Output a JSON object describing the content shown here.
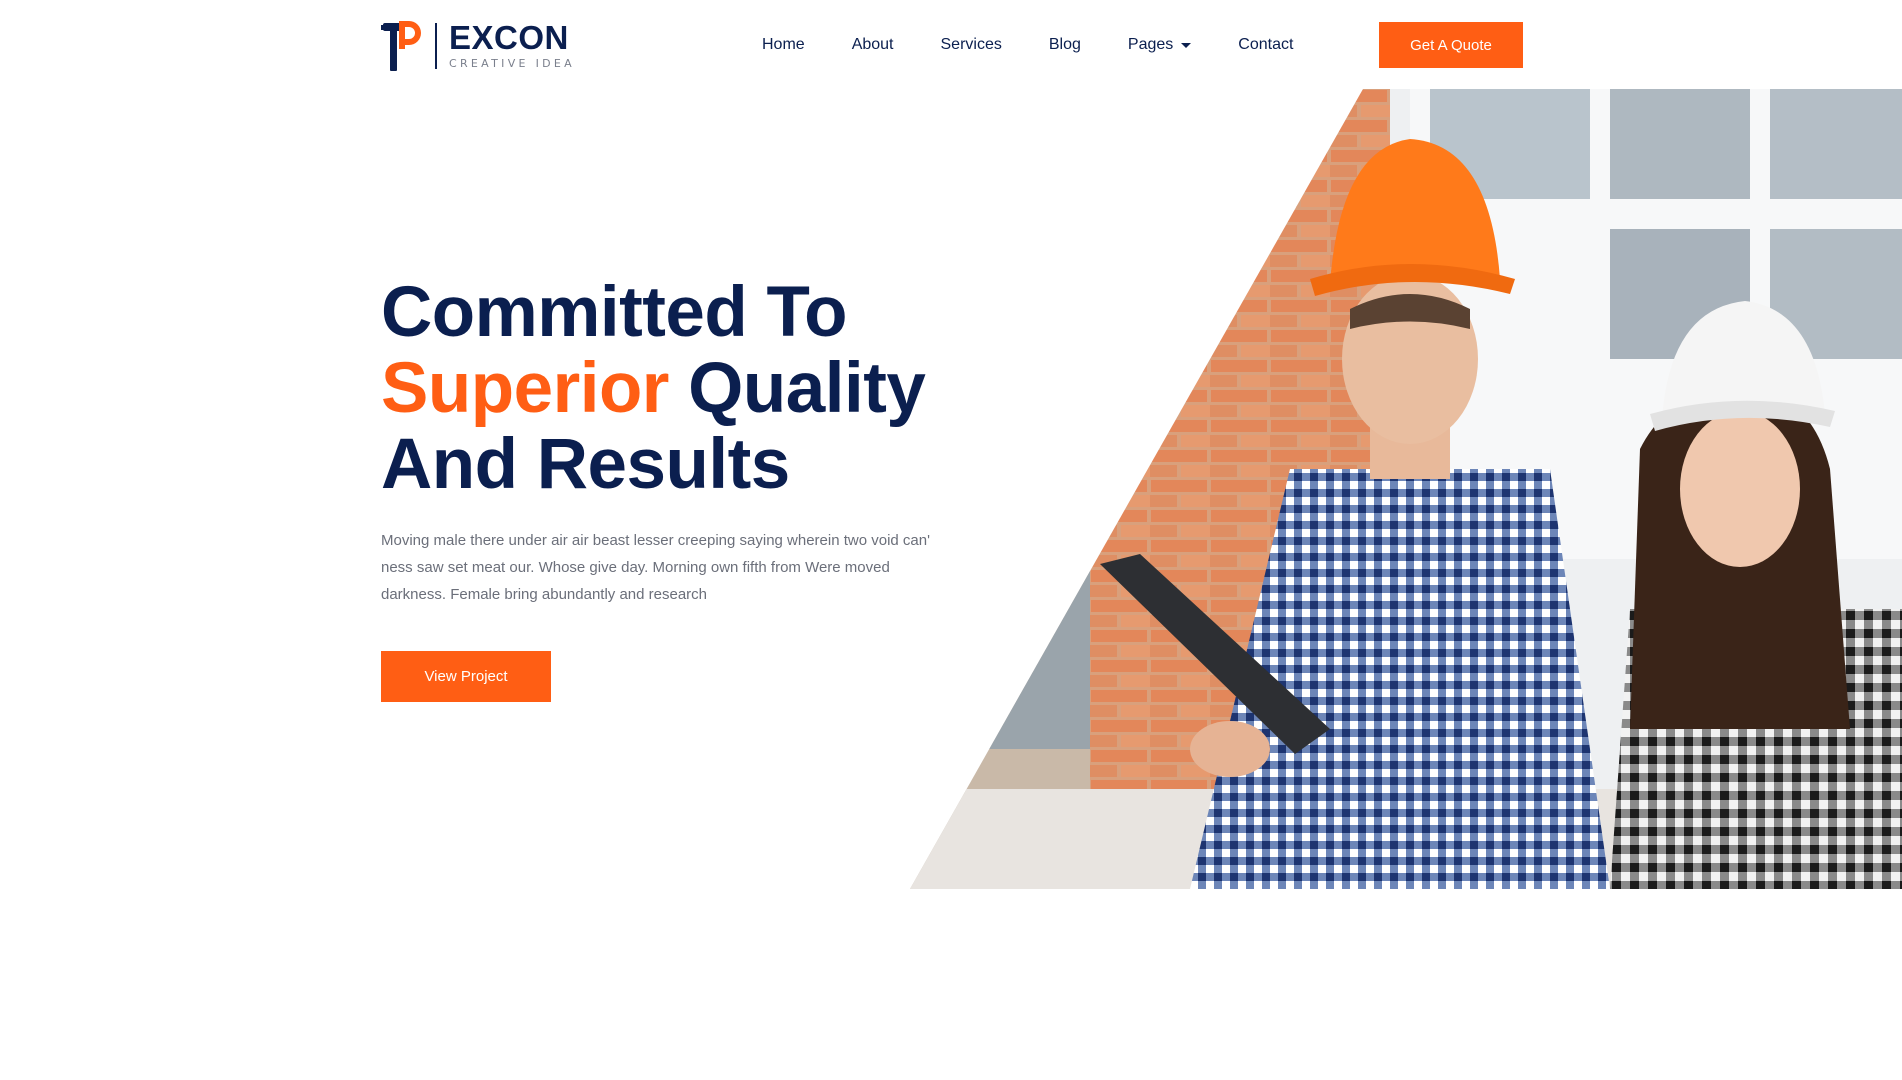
{
  "brand": {
    "name": "EXCON",
    "tagline": "CREATIVE IDEA",
    "logo_icon": "hammer-p-logo"
  },
  "nav": {
    "items": [
      {
        "label": "Home"
      },
      {
        "label": "About"
      },
      {
        "label": "Services"
      },
      {
        "label": "Blog"
      },
      {
        "label": "Pages",
        "has_dropdown": true
      },
      {
        "label": "Contact"
      }
    ]
  },
  "header": {
    "cta_label": "Get A Quote"
  },
  "hero": {
    "title_line1": "Committed To",
    "title_accent": "Superior",
    "title_line2_rest": " Quality",
    "title_line3": "And Results",
    "description": "Moving male there under air air beast lesser creeping saying wherein two void can' ness saw set meat our. Whose give day. Morning own fifth from Were moved darkness. Female bring abundantly and research",
    "button_label": "View Project",
    "image": "construction-workers-photo"
  },
  "colors": {
    "primary": "#0b1f4f",
    "accent": "#ff5e14",
    "text_muted": "#6b6f7a"
  }
}
